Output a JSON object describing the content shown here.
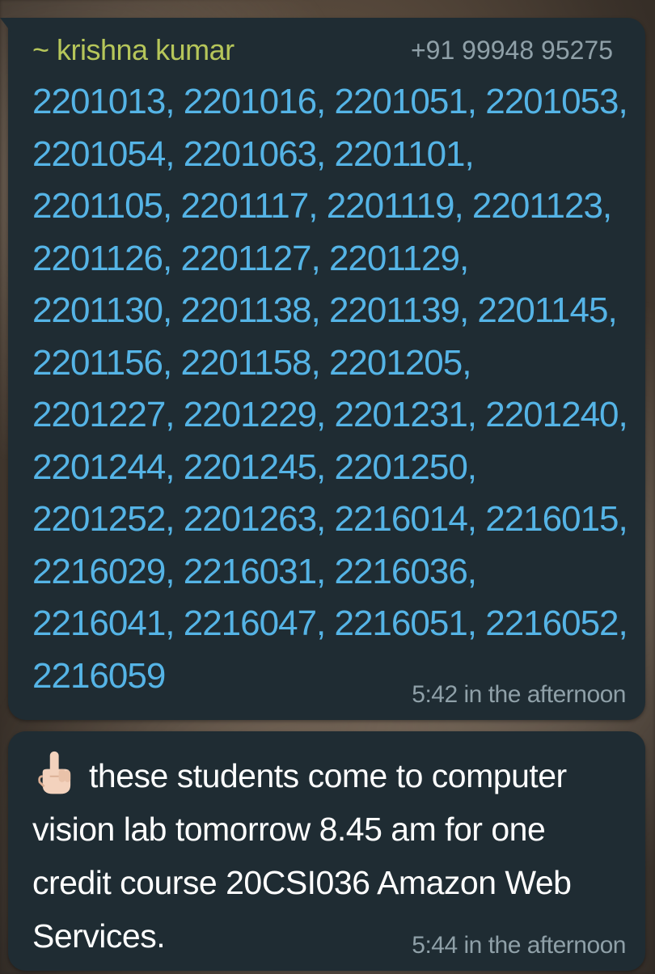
{
  "message_1": {
    "sender_name": "~ krishna kumar",
    "sender_phone": "+91 99948 95275",
    "number_lines": [
      "2201013, 2201016, 2201051, 2201053,",
      "2201054, 2201063, 2201101,",
      "2201105, 2201117, 2201119, 2201123,",
      "2201126, 2201127, 2201129,",
      "2201130, 2201138, 2201139, 2201145,",
      "2201156, 2201158, 2201205,",
      "2201227, 2201229, 2201231, 2201240,",
      "2201244, 2201245, 2201250,",
      "2201252, 2201263, 2216014, 2216015,",
      "2216029, 2216031, 2216036,",
      "2216041, 2216047, 2216051, 2216052,",
      "2216059"
    ],
    "timestamp": "5:42 in the afternoon"
  },
  "message_2": {
    "emoji": "pointing-up-hand-icon",
    "text": "these students come to computer vision lab tomorrow 8.45 am for one credit course 20CSI036 Amazon Web Services.",
    "timestamp": "5:44 in the afternoon"
  },
  "colors": {
    "bubble_bg": "#1f2c33",
    "sender_name": "#b6c65a",
    "link_numbers": "#55b4e6",
    "meta_text": "#8fa0a8",
    "message_text": "#ffffff"
  }
}
